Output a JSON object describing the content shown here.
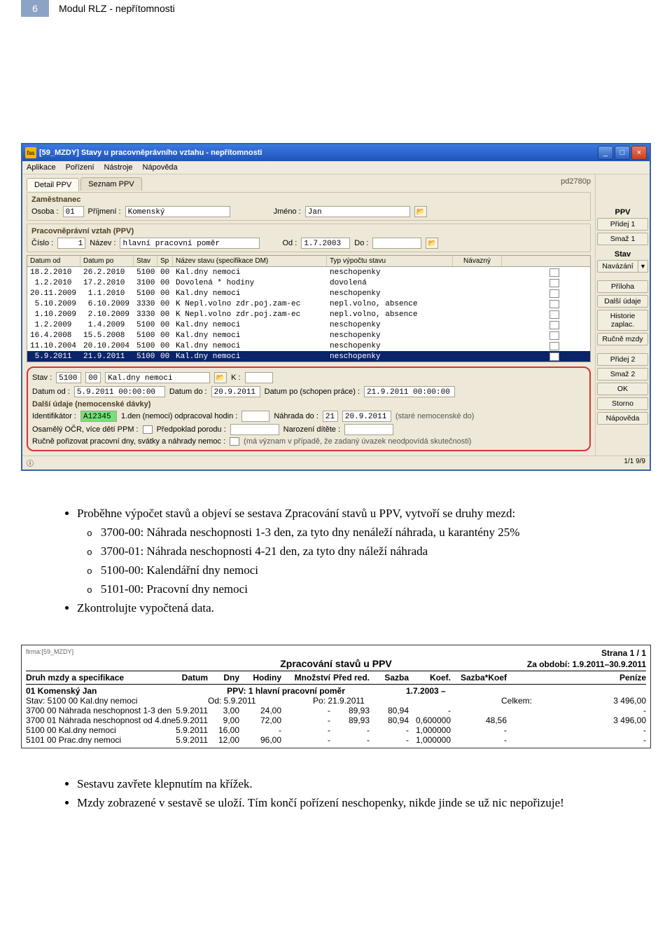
{
  "header": {
    "page_num": "6",
    "title": "Modul RLZ - nepřítomnosti"
  },
  "win": {
    "title": "[59_MZDY] Stavy u pracovněprávního vztahu - nepřítomnosti",
    "menu": [
      "Aplikace",
      "Pořízení",
      "Nástroje",
      "Nápověda"
    ],
    "user": "pd2780p",
    "tabs": [
      "Detail PPV",
      "Seznam PPV"
    ],
    "zamestnanec": {
      "title": "Zaměstnanec",
      "osoba_lbl": "Osoba :",
      "osoba": "01",
      "prijmeni_lbl": "Příjmení :",
      "prijmeni": "Komenský",
      "jmeno_lbl": "Jméno :",
      "jmeno": "Jan"
    },
    "ppv": {
      "title": "Pracovněprávní vztah (PPV)",
      "cislo_lbl": "Číslo :",
      "cislo": "1",
      "nazev_lbl": "Název :",
      "nazev": "hlavní pracovní poměr",
      "od_lbl": "Od :",
      "od": "1.7.2003",
      "do_lbl": "Do :",
      "do": ""
    },
    "grid": {
      "head": [
        "Datum od",
        "Datum po",
        "Stav",
        "Sp",
        "Název stavu (specifikace DM)",
        "Typ výpočtu stavu",
        "Návazný"
      ],
      "rows": [
        {
          "od": "18.2.2010",
          "po": "26.2.2010",
          "stav": "5100",
          "sp": "00",
          "nazev": "Kal.dny nemoci",
          "typ": "neschopenky"
        },
        {
          "od": " 1.2.2010",
          "po": "17.2.2010",
          "stav": "3100",
          "sp": "00",
          "nazev": "Dovolená * hodiny",
          "typ": "dovolená"
        },
        {
          "od": "20.11.2009",
          "po": " 1.1.2010",
          "stav": "5100",
          "sp": "00",
          "nazev": "Kal.dny nemoci",
          "typ": "neschopenky"
        },
        {
          "od": " 5.10.2009",
          "po": " 6.10.2009",
          "stav": "3330",
          "sp": "00",
          "nazev": "K Nepl.volno zdr.poj.zam-ec",
          "typ": "nepl.volno, absence"
        },
        {
          "od": " 1.10.2009",
          "po": " 2.10.2009",
          "stav": "3330",
          "sp": "00",
          "nazev": "K Nepl.volno zdr.poj.zam-ec",
          "typ": "nepl.volno, absence"
        },
        {
          "od": " 1.2.2009",
          "po": " 1.4.2009",
          "stav": "5100",
          "sp": "00",
          "nazev": "Kal.dny nemoci",
          "typ": "neschopenky"
        },
        {
          "od": "16.4.2008",
          "po": "15.5.2008",
          "stav": "5100",
          "sp": "00",
          "nazev": "Kal.dny nemoci",
          "typ": "neschopenky"
        },
        {
          "od": "11.10.2004",
          "po": "20.10.2004",
          "stav": "5100",
          "sp": "00",
          "nazev": "Kal.dny nemoci",
          "typ": "neschopenky"
        },
        {
          "od": " 5.9.2011",
          "po": "21.9.2011",
          "stav": "5100",
          "sp": "00",
          "nazev": "Kal.dny nemoci",
          "typ": "neschopenky",
          "sel": true
        }
      ]
    },
    "detail": {
      "stav_lbl": "Stav :",
      "stav_code": "5100",
      "stav_sp": "00",
      "stav_name": "Kal.dny nemoci",
      "k_lbl": "K :",
      "datumod_lbl": "Datum od :",
      "datumod": "5.9.2011 00:00:00",
      "datumdo_lbl": "Datum do :",
      "datumdo": "20.9.2011",
      "datumpo_lbl": "Datum po (schopen práce) :",
      "datumpo": "21.9.2011 00:00:00",
      "dalsi_title": "Další údaje (nemocenské dávky)",
      "ident_lbl": "Identifikátor :",
      "ident": "A12345",
      "den1_lbl": "1.den (nemoci) odpracoval hodin :",
      "den1": "",
      "nahrada_lbl": "Náhrada do :",
      "nahrada_den": "21",
      "nahrada": "20.9.2011",
      "nahrada_note": "(staré nemocenské do)",
      "ocr_lbl": "Osamělý OČR, více dětí PPM :",
      "porod_lbl": "Předpoklad porodu :",
      "porod": "",
      "narozeni_lbl": "Narození dítěte :",
      "narozeni": "",
      "rucne_lbl": "Ručně pořizovat pracovní dny, svátky a náhrady nemoc :",
      "rucne_note": "(má význam v případě, že zadaný úvazek neodpovídá skutečnosti)"
    },
    "side": {
      "ppv": "PPV",
      "pridej1": "Přidej 1",
      "smaz1": "Smaž 1",
      "stav": "Stav",
      "navazani": "Navázání",
      "priloha": "Příloha",
      "dalsi": "Další údaje",
      "historie": "Historie zaplac.",
      "rucne": "Ručně mzdy",
      "pridej2": "Přidej 2",
      "smaz2": "Smaž 2",
      "ok": "OK",
      "storno": "Storno",
      "napoveda": "Nápověda"
    },
    "status": "1/1  9/9"
  },
  "body": {
    "b1": "Proběhne výpočet stavů a objeví se sestava Zpracování stavů u PPV, vytvoří se druhy mezd:",
    "s1": "3700-00: Náhrada neschopnosti 1-3 den, za tyto dny nenáleží náhrada, u karantény 25%",
    "s2": "3700-01: Náhrada neschopnosti 4-21 den, za tyto dny náleží náhrada",
    "s3": "5100-00: Kalendářní dny nemoci",
    "s4": "5101-00: Pracovní dny nemoci",
    "b2": "Zkontrolujte vypočtená data.",
    "b3": "Sestavu zavřete klepnutím na křížek.",
    "b4": "Mzdy zobrazené v sestavě se uloží. Tím končí pořízení neschopenky, nikde jinde se už nic nepořizuje!"
  },
  "report": {
    "src": "firma:[59_MZDY]",
    "strana": "Strana 1 / 1",
    "title": "Zpracování stavů u PPV",
    "period": "Za období: 1.9.2011–30.9.2011",
    "head": [
      "Druh mzdy a specifikace",
      "Datum",
      "Dny",
      "Hodiny",
      "Množství",
      "Před red.",
      "Sazba",
      "Koef.",
      "Sazba*Koef",
      "Peníze"
    ],
    "emp_name": "01 Komenský Jan",
    "emp_ppv_lbl": "PPV:",
    "emp_ppv": "1 hlavní pracovní poměr",
    "emp_ppv_date": "1.7.2003 –",
    "stav": "Stav:  5100  00 Kal.dny nemoci",
    "stav_od": "Od: 5.9.2011",
    "stav_po": "Po: 21.9.2011",
    "celkem_lbl": "Celkem:",
    "celkem": "3 496,00",
    "rows": [
      {
        "c1": "3700  00 Náhrada neschopnost 1-3 den",
        "c2": "5.9.2011",
        "c3": "3,00",
        "c4": "24,00",
        "c5": "-",
        "c6": "89,93",
        "c7": "80,94",
        "c8": "-",
        "c9": "",
        "c10": "-"
      },
      {
        "c1": "3700  01 Náhrada neschopnost od 4.dne",
        "c2": "5.9.2011",
        "c3": "9,00",
        "c4": "72,00",
        "c5": "-",
        "c6": "89,93",
        "c7": "80,94",
        "c8": "0,600000",
        "c9": "48,56",
        "c10": "3 496,00"
      },
      {
        "c1": "5100  00 Kal.dny nemoci",
        "c2": "5.9.2011",
        "c3": "16,00",
        "c4": "-",
        "c5": "-",
        "c6": "-",
        "c7": "-",
        "c8": "1,000000",
        "c9": "-",
        "c10": "-"
      },
      {
        "c1": "5101  00 Prac.dny nemoci",
        "c2": "5.9.2011",
        "c3": "12,00",
        "c4": "96,00",
        "c5": "-",
        "c6": "-",
        "c7": "-",
        "c8": "1,000000",
        "c9": "-",
        "c10": "-"
      }
    ]
  }
}
